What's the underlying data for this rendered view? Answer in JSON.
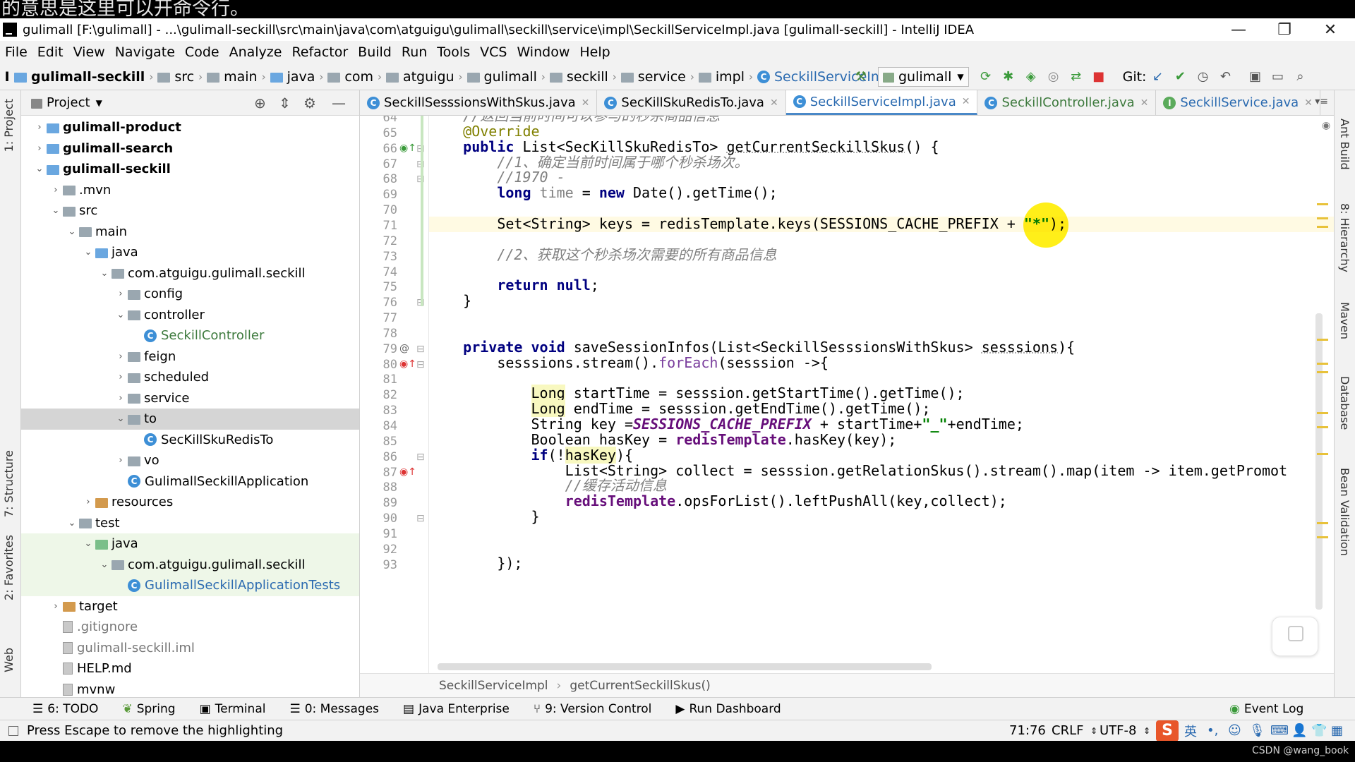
{
  "overlay_text": "的意思是这里可以开命令行。",
  "window": {
    "title": "gulimall [F:\\gulimall] - ...\\gulimall-seckill\\src\\main\\java\\com\\atguigu\\gulimall\\seckill\\service\\impl\\SeckillServiceImpl.java [gulimall-seckill] - IntelliJ IDEA",
    "minimize": "—",
    "restore": "❐",
    "close": "✕"
  },
  "menu": [
    "File",
    "Edit",
    "View",
    "Navigate",
    "Code",
    "Analyze",
    "Refactor",
    "Build",
    "Run",
    "Tools",
    "VCS",
    "Window",
    "Help"
  ],
  "nav": {
    "crumbs": [
      "gulimall-seckill",
      "src",
      "main",
      "java",
      "com",
      "atguigu",
      "gulimall",
      "seckill",
      "service",
      "impl",
      "SeckillServiceImpl"
    ],
    "run_config": "gulimall",
    "git_label": "Git:"
  },
  "project": {
    "header": "Project",
    "tree": [
      {
        "label": "gulimall-product",
        "depth": 1,
        "arrow": "›",
        "type": "module",
        "bold": true
      },
      {
        "label": "gulimall-search",
        "depth": 1,
        "arrow": "›",
        "type": "module",
        "bold": true
      },
      {
        "label": "gulimall-seckill",
        "depth": 1,
        "arrow": "⌄",
        "type": "module",
        "bold": true
      },
      {
        "label": ".mvn",
        "depth": 2,
        "arrow": "›",
        "type": "folder"
      },
      {
        "label": "src",
        "depth": 2,
        "arrow": "⌄",
        "type": "folder"
      },
      {
        "label": "main",
        "depth": 3,
        "arrow": "⌄",
        "type": "folder"
      },
      {
        "label": "java",
        "depth": 4,
        "arrow": "⌄",
        "type": "src"
      },
      {
        "label": "com.atguigu.gulimall.seckill",
        "depth": 5,
        "arrow": "⌄",
        "type": "folder"
      },
      {
        "label": "config",
        "depth": 6,
        "arrow": "›",
        "type": "folder"
      },
      {
        "label": "controller",
        "depth": 6,
        "arrow": "⌄",
        "type": "folder"
      },
      {
        "label": "SeckillController",
        "depth": 7,
        "arrow": "",
        "type": "class",
        "color": "#3d7a3d"
      },
      {
        "label": "feign",
        "depth": 6,
        "arrow": "›",
        "type": "folder"
      },
      {
        "label": "scheduled",
        "depth": 6,
        "arrow": "›",
        "type": "folder"
      },
      {
        "label": "service",
        "depth": 6,
        "arrow": "›",
        "type": "folder"
      },
      {
        "label": "to",
        "depth": 6,
        "arrow": "⌄",
        "type": "folder",
        "selected": true
      },
      {
        "label": "SecKillSkuRedisTo",
        "depth": 7,
        "arrow": "",
        "type": "class"
      },
      {
        "label": "vo",
        "depth": 6,
        "arrow": "›",
        "type": "folder"
      },
      {
        "label": "GulimallSeckillApplication",
        "depth": 6,
        "arrow": "",
        "type": "class"
      },
      {
        "label": "resources",
        "depth": 4,
        "arrow": "›",
        "type": "res"
      },
      {
        "label": "test",
        "depth": 3,
        "arrow": "⌄",
        "type": "folder"
      },
      {
        "label": "java",
        "depth": 4,
        "arrow": "⌄",
        "type": "test",
        "green": true
      },
      {
        "label": "com.atguigu.gulimall.seckill",
        "depth": 5,
        "arrow": "⌄",
        "type": "folder",
        "green": true
      },
      {
        "label": "GulimallSeckillApplicationTests",
        "depth": 6,
        "arrow": "",
        "type": "class",
        "color": "#2a6ab0",
        "green": true
      },
      {
        "label": "target",
        "depth": 2,
        "arrow": "›",
        "type": "target"
      },
      {
        "label": ".gitignore",
        "depth": 2,
        "arrow": "",
        "type": "file",
        "color": "#777"
      },
      {
        "label": "gulimall-seckill.iml",
        "depth": 2,
        "arrow": "",
        "type": "file",
        "color": "#777"
      },
      {
        "label": "HELP.md",
        "depth": 2,
        "arrow": "",
        "type": "md"
      },
      {
        "label": "mvnw",
        "depth": 2,
        "arrow": "",
        "type": "file"
      }
    ]
  },
  "tabs": [
    {
      "label": "SeckillSesssionsWithSkus.java",
      "color": "#000"
    },
    {
      "label": "SecKillSkuRedisTo.java",
      "color": "#000"
    },
    {
      "label": "SeckillServiceImpl.java",
      "color": "#2a6ab0",
      "active": true
    },
    {
      "label": "SeckillController.java",
      "color": "#3d7a3d"
    },
    {
      "label": "SeckillService.java",
      "color": "#2a6ab0",
      "interface": true
    }
  ],
  "left_strip": [
    "1: Project",
    "7: Structure",
    "2: Favorites",
    "Web"
  ],
  "right_strip": [
    "Ant Build",
    "8: Hierarchy",
    "Maven",
    "Database",
    "Bean Validation"
  ],
  "editor": {
    "lines": [
      {
        "n": 64,
        "html": "    <span class=\"cm\">//返回当前时间可以参与的秒杀商品信息</span>"
      },
      {
        "n": 65,
        "html": "    <span class=\"an\">@Override</span>"
      },
      {
        "n": 66,
        "html": "    <span class=\"kw\">public</span> List&lt;SecKillSkuRedisTo&gt; <span class=\"sq\">getCurrentSeckillSkus</span>() {"
      },
      {
        "n": 67,
        "html": "        <span class=\"cm\">//1、确定当前时间属于哪个秒杀场次。</span>"
      },
      {
        "n": 68,
        "html": "        <span class=\"cm\">//1970 -</span>"
      },
      {
        "n": 69,
        "html": "        <span class=\"kw\">long</span> <span class=\"mv\">time</span> = <span class=\"kw\">new</span> Date().getTime();"
      },
      {
        "n": 70,
        "html": ""
      },
      {
        "n": 71,
        "html": "        Set&lt;String&gt; keys = redisTemplate.keys(SESSIONS_CACHE_PREFIX + <span class=\"st\">\"*\"</span>);"
      },
      {
        "n": 72,
        "html": ""
      },
      {
        "n": 73,
        "html": "        <span class=\"cm\">//2、获取这个秒杀场次需要的所有商品信息</span>"
      },
      {
        "n": 74,
        "html": ""
      },
      {
        "n": 75,
        "html": "        <span class=\"kw\">return null</span>;"
      },
      {
        "n": 76,
        "html": "    }"
      },
      {
        "n": 77,
        "html": ""
      },
      {
        "n": 78,
        "html": ""
      },
      {
        "n": 79,
        "html": "    <span class=\"kw\">private void</span> saveSessionInfos(List&lt;SeckillSesssionsWithSkus&gt; <span class=\"sq\">sesssions</span>){"
      },
      {
        "n": 80,
        "html": "        sesssions.stream().<span style=\"color:#7a3e9d\">forEach</span>(sesssion -&gt;{"
      },
      {
        "n": 81,
        "html": ""
      },
      {
        "n": 82,
        "html": "            <span class=\"hl-type\">Long</span> startTime = sesssion.getStartTime().getTime();"
      },
      {
        "n": 83,
        "html": "            <span class=\"hl-type\">Long</span> endTime = sesssion.getEndTime().getTime();"
      },
      {
        "n": 84,
        "html": "            String key =<span class=\"cn\">SESSIONS_CACHE_PREFIX</span> + startTime+<span class=\"st\">\"_\"</span>+endTime;"
      },
      {
        "n": 85,
        "html": "            Boolean hasKey = <span class=\"fld\">redisTemplate</span>.hasKey(key);"
      },
      {
        "n": 86,
        "html": "            <span class=\"kw\">if</span>(!<span class=\"hl-type\">hasKey</span>){"
      },
      {
        "n": 87,
        "html": "                List&lt;String&gt; collect = sesssion.getRelationSkus().stream().map(item -&gt; item.getPromot"
      },
      {
        "n": 88,
        "html": "                <span class=\"cm\">//缓存活动信息</span>"
      },
      {
        "n": 89,
        "html": "                <span class=\"fld\">redisTemplate</span>.opsForList().leftPushAll(key,collect);"
      },
      {
        "n": 90,
        "html": "            }"
      },
      {
        "n": 91,
        "html": ""
      },
      {
        "n": 92,
        "html": ""
      },
      {
        "n": 93,
        "html": "        });"
      }
    ]
  },
  "breadcrumb": [
    "SeckillServiceImpl",
    "getCurrentSeckillSkus()"
  ],
  "bottom_tools": [
    "6: TODO",
    "Spring",
    "Terminal",
    "0: Messages",
    "Java Enterprise",
    "9: Version Control",
    "Run Dashboard"
  ],
  "event_log": "Event Log",
  "status": {
    "message": "Press Escape to remove the highlighting",
    "position": "71:76",
    "line_sep": "CRLF",
    "encoding": "UTF-8",
    "ime": "英"
  },
  "watermark": "CSDN @wang_book",
  "colors": {
    "accent": "#4a88c7",
    "cursor_highlight": "#ffee00"
  }
}
